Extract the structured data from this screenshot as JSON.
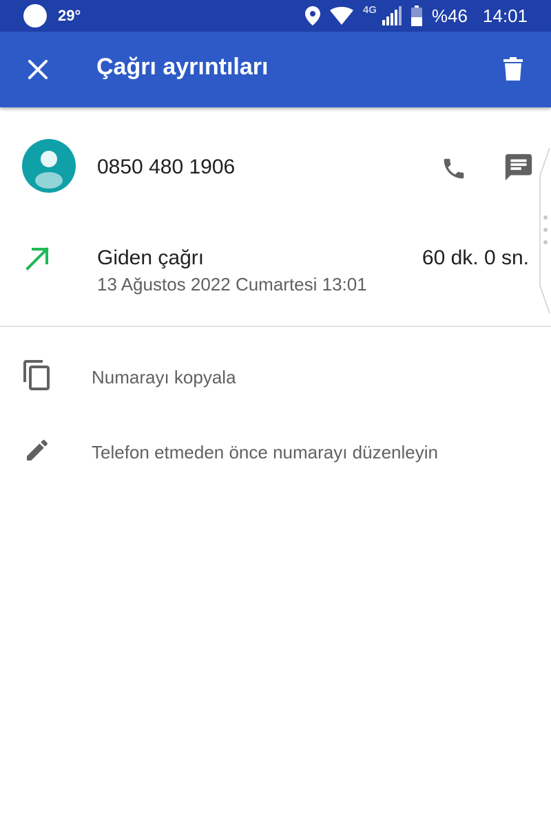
{
  "status_bar": {
    "temperature": "29°",
    "network_type": "4G",
    "battery": "%46",
    "time": "14:01"
  },
  "app_bar": {
    "title": "Çağrı ayrıntıları",
    "close_icon": "close-icon",
    "delete_icon": "trash-icon"
  },
  "contact": {
    "phone_number": "0850 480 1906",
    "avatar_color": "#10a0a8"
  },
  "call": {
    "type": "Giden çağrı",
    "date": "13 Ağustos 2022 Cumartesi 13:01",
    "duration": "60 dk. 0 sn.",
    "direction_color": "#1db954"
  },
  "actions": [
    {
      "label": "Numarayı kopyala",
      "icon": "copy-icon"
    },
    {
      "label": "Telefon etmeden önce numarayı düzenleyin",
      "icon": "edit-pencil-icon"
    }
  ],
  "colors": {
    "status_bar": "#1f3fa9",
    "app_bar": "#2d5ac6",
    "icon_gray": "#616161"
  }
}
